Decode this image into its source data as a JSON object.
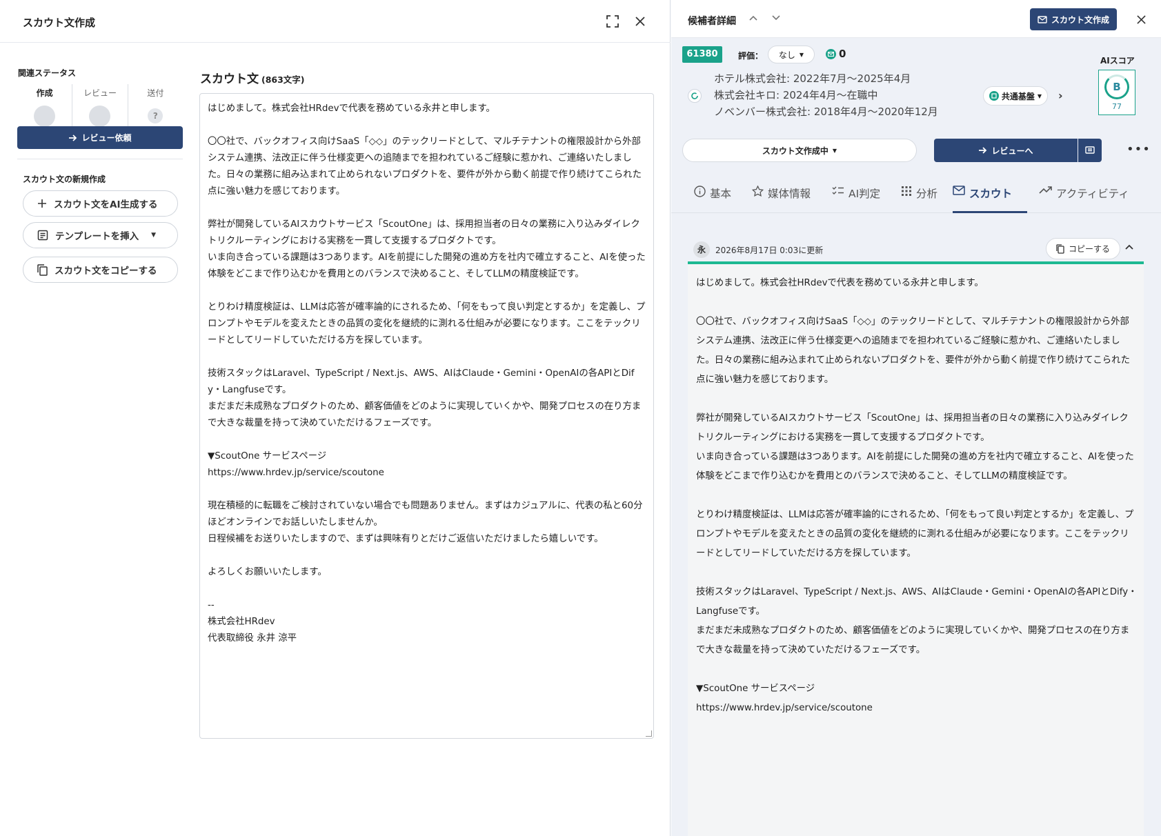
{
  "left": {
    "title": "スカウト文作成",
    "status_title": "関連ステータス",
    "status_steps": [
      {
        "label": "作成"
      },
      {
        "label": "レビュー"
      },
      {
        "label": "送付",
        "mark": "?"
      }
    ],
    "review_request_label": "レビュー依頼",
    "new_section_title": "スカウト文の新規作成",
    "buttons": {
      "ai_generate": "スカウト文をAI生成する",
      "insert_template": "テンプレートを挿入",
      "copy_text": "スカウト文をコピーする"
    },
    "editor": {
      "title": "スカウト文",
      "char_count": "(863文字)",
      "text": "はじめまして。株式会社HRdevで代表を務めている永井と申します。\n\n〇〇社で、バックオフィス向けSaaS「◇◇」のテックリードとして、マルチテナントの権限設計から外部システム連携、法改正に伴う仕様変更への追随までを担われているご経験に惹かれ、ご連絡いたしました。日々の業務に組み込まれて止められないプロダクトを、要件が外から動く前提で作り続けてこられた点に強い魅力を感じております。\n\n弊社が開発しているAIスカウトサービス「ScoutOne」は、採用担当者の日々の業務に入り込みダイレクトリクルーティングにおける実務を一貫して支援するプロダクトです。\nいま向き合っている課題は3つあります。AIを前提にした開発の進め方を社内で確立すること、AIを使った体験をどこまで作り込むかを費用とのバランスで決めること、そしてLLMの精度検証です。\n\nとりわけ精度検証は、LLMは応答が確率論的にされるため、「何をもって良い判定とするか」を定義し、プロンプトやモデルを変えたときの品質の変化を継続的に測れる仕組みが必要になります。ここをテックリードとしてリードしていただける方を探しています。\n\n技術スタックはLaravel、TypeScript / Next.js、AWS、AIはClaude・Gemini・OpenAIの各APIとDify・Langfuseです。\nまだまだ未成熟なプロダクトのため、顧客価値をどのように実現していくかや、開発プロセスの在り方まで大きな裁量を持って決めていただけるフェーズです。\n\n▼ScoutOne サービスページ\nhttps://www.hrdev.jp/service/scoutone\n\n現在積極的に転職をご検討されていない場合でも問題ありません。まずはカジュアルに、代表の私と60分ほどオンラインでお話しいたしませんか。\n日程候補をお送りいたしますので、まずは興味有りとだけご返信いただけましたら嬉しいです。\n\nよろしくお願いいたします。\n\n--\n株式会社HRdev\n代表取締役 永井 涼平"
    }
  },
  "right": {
    "title": "候補者詳細",
    "scout_create_label": "スカウト文作成",
    "candidate": {
      "id": "61380",
      "rating_label": "評価：",
      "rating_value": "なし",
      "mail_count": "0",
      "careers": [
        "ホテル株式会社: 2022年7月〜2025年4月",
        "株式会社キロ: 2024年4月〜在職中",
        "ノベンバー株式会社: 2018年4月〜2020年12月"
      ],
      "tag": "共通基盤",
      "ai_score_label": "AIスコア",
      "ai_grade": "B",
      "ai_score": "77"
    },
    "status_select": "スカウト文作成中",
    "to_review_label": "レビューへ",
    "tabs": [
      "基本",
      "媒体情報",
      "AI判定",
      "分析",
      "スカウト",
      "アクティビティ"
    ],
    "active_tab": "スカウト",
    "scout": {
      "avatar_char": "永",
      "updated": "2026年8月17日 0:03に更新",
      "copy_label": "コピーする",
      "body": "はじめまして。株式会社HRdevで代表を務めている永井と申します。\n\n〇〇社で、バックオフィス向けSaaS「◇◇」のテックリードとして、マルチテナントの権限設計から外部システム連携、法改正に伴う仕様変更への追随までを担われているご経験に惹かれ、ご連絡いたしました。日々の業務に組み込まれて止められないプロダクトを、要件が外から動く前提で作り続けてこられた点に強い魅力を感じております。\n\n弊社が開発しているAIスカウトサービス「ScoutOne」は、採用担当者の日々の業務に入り込みダイレクトリクルーティングにおける実務を一貫して支援するプロダクトです。\nいま向き合っている課題は3つあります。AIを前提にした開発の進め方を社内で確立すること、AIを使った体験をどこまで作り込むかを費用とのバランスで決めること、そしてLLMの精度検証です。\n\nとりわけ精度検証は、LLMは応答が確率論的にされるため、「何をもって良い判定とするか」を定義し、プロンプトやモデルを変えたときの品質の変化を継続的に測れる仕組みが必要になります。ここをテックリードとしてリードしていただける方を探しています。\n\n技術スタックはLaravel、TypeScript / Next.js、AWS、AIはClaude・Gemini・OpenAIの各APIとDify・Langfuseです。\nまだまだ未成熟なプロダクトのため、顧客価値をどのように実現していくかや、開発プロセスの在り方まで大きな裁量を持って決めていただけるフェーズです。\n\n▼ScoutOne サービスページ\nhttps://www.hrdev.jp/service/scoutone"
    }
  },
  "colors": {
    "primary_navy": "#2c4675",
    "accent_green": "#1aa28a",
    "tab_underline_green": "#1db992"
  }
}
